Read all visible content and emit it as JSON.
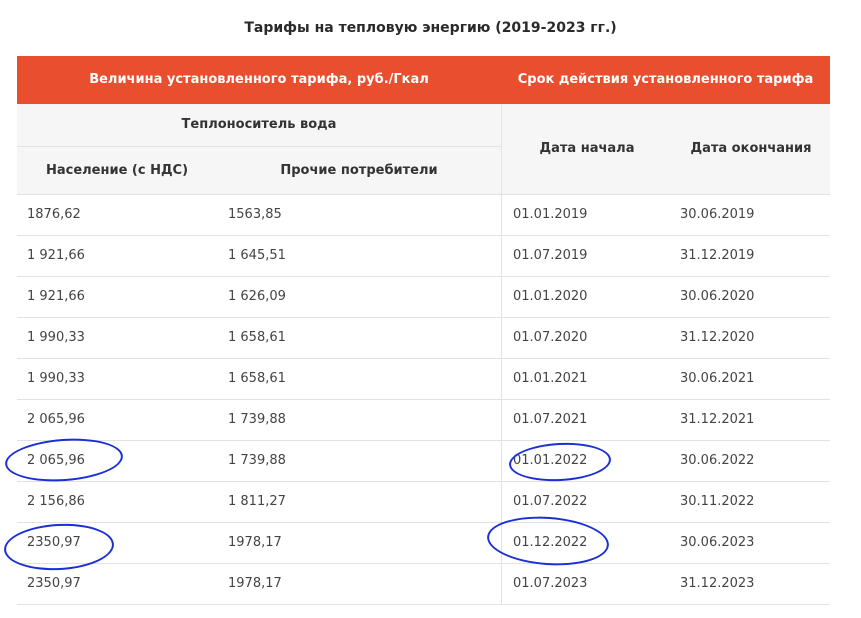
{
  "title": "Тарифы на тепловую энергию (2019-2023 гг.)",
  "header": {
    "tariff": "Величина установленного тарифа, руб./Гкал",
    "period": "Срок действия установленного тарифа"
  },
  "subheader": {
    "water": "Теплоноситель вода",
    "population": "Население (с НДС)",
    "other": "Прочие потребители",
    "start": "Дата начала",
    "end": "Дата окончания"
  },
  "rows": [
    {
      "pop": "1876,62",
      "other": "1563,85",
      "start": "01.01.2019",
      "end": "30.06.2019"
    },
    {
      "pop": "1 921,66",
      "other": "1 645,51",
      "start": "01.07.2019",
      "end": "31.12.2019"
    },
    {
      "pop": "1 921,66",
      "other": "1 626,09",
      "start": "01.01.2020",
      "end": "30.06.2020"
    },
    {
      "pop": "1 990,33",
      "other": "1 658,61",
      "start": "01.07.2020",
      "end": " 31.12.2020"
    },
    {
      "pop": "1 990,33",
      "other": "1 658,61",
      "start": "01.01.2021",
      "end": "30.06.2021"
    },
    {
      "pop": "2 065,96",
      "other": "1 739,88",
      "start": "01.07.2021",
      "end": "31.12.2021"
    },
    {
      "pop": "2 065,96",
      "other": "1 739,88",
      "start": "01.01.2022",
      "end": "30.06.2022"
    },
    {
      "pop": "2 156,86",
      "other": "1 811,27",
      "start": "01.07.2022",
      "end": "30.11.2022"
    },
    {
      "pop": "2350,97",
      "other": "1978,17",
      "start": "01.12.2022",
      "end": "30.06.2023"
    },
    {
      "pop": "2350,97",
      "other": "1978,17",
      "start": "01.07.2023",
      "end": "31.12.2023"
    }
  ],
  "colors": {
    "header_bg": "#e94f2e",
    "annotation": "#1a2fd6"
  }
}
